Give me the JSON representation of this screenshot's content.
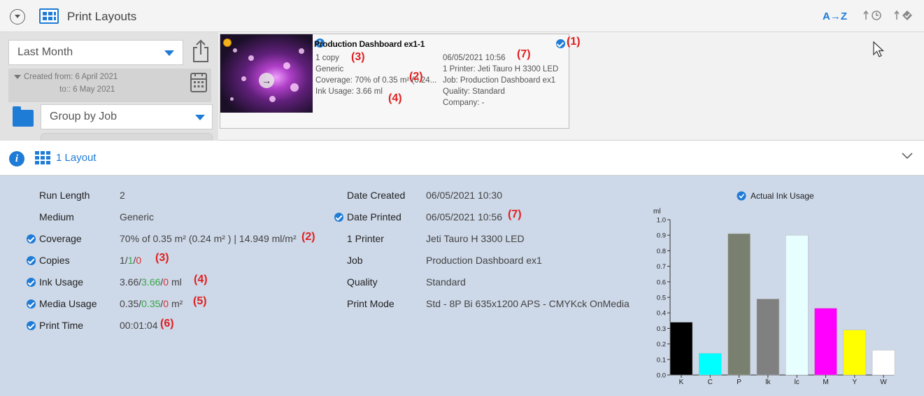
{
  "topbar": {
    "title": "Print Layouts",
    "sort_az": "A→Z",
    "sort_time": "↑🕒",
    "sort_check": "↑◆"
  },
  "filters": {
    "period": "Last Month",
    "created_from": "Created from: 6 April 2021",
    "created_to": "to:: 6 May 2021",
    "group_by": "Group by Job"
  },
  "card": {
    "title": "Production Dashboard ex1-1",
    "info_badge": "1",
    "left": {
      "copies": "1 copy",
      "medium": "Generic",
      "coverage": "Coverage:  70% of 0.35 m² (0.24...",
      "ink_usage": "Ink Usage: 3.66 ml"
    },
    "right": {
      "date": "06/05/2021 10:56",
      "printer": "1 Printer: Jeti Tauro H 3300 LED",
      "job": "Job: Production Dashboard ex1",
      "quality": "Quality: Standard",
      "company": "Company:  -"
    }
  },
  "annotations": {
    "a1": "(1)",
    "a2": "(2)",
    "a3": "(3)",
    "a4": "(4)",
    "a5": "(5)",
    "a6": "(6)",
    "a7": "(7)"
  },
  "details_header": {
    "layout_count": "1 Layout"
  },
  "details": {
    "run_length_label": "Run Length",
    "run_length_value": "2",
    "medium_label": "Medium",
    "medium_value": "Generic",
    "coverage_label": "Coverage",
    "coverage_value": "70% of 0.35 m² (0.24 m² )  |  14.949 ml/m²",
    "copies_label": "Copies",
    "copies": {
      "a": "1",
      "b": "1",
      "c": "0",
      "sep": "/"
    },
    "ink_label": "Ink Usage",
    "ink": {
      "a": "3.66",
      "b": "3.66",
      "c": "0",
      "unit": " ml"
    },
    "media_label": "Media Usage",
    "media": {
      "a": "0.35",
      "b": "0.35",
      "c": "0",
      "unit": " m²"
    },
    "print_time_label": "Print Time",
    "print_time_value": "00:01:04",
    "date_created_label": "Date Created",
    "date_created_value": "06/05/2021 10:30",
    "date_printed_label": "Date Printed",
    "date_printed_value": "06/05/2021 10:56",
    "printer_label": "1 Printer",
    "printer_value": "Jeti Tauro H 3300 LED",
    "job_label": "Job",
    "job_value": "Production Dashboard ex1",
    "quality_label": "Quality",
    "quality_value": "Standard",
    "print_mode_label": "Print Mode",
    "print_mode_value": "Std - 8P Bi 635x1200 APS - CMYKck OnMedia"
  },
  "colors": {
    "accent": "#1e7bd6",
    "annotation": "#e02020",
    "panel_bg": "#cdd8e8"
  },
  "chart_data": {
    "type": "bar",
    "title": "Actual Ink Usage",
    "ylabel": "ml",
    "xlabel": "",
    "ylim": [
      0,
      1.0
    ],
    "yticks": [
      "0.0",
      "0.1",
      "0.2",
      "0.3",
      "0.4",
      "0.5",
      "0.6",
      "0.7",
      "0.8",
      "0.9",
      "1.0"
    ],
    "categories": [
      "K",
      "C",
      "P",
      "lk",
      "lc",
      "M",
      "Y",
      "W"
    ],
    "values": [
      0.34,
      0.14,
      0.91,
      0.49,
      0.9,
      0.43,
      0.29,
      0.16
    ],
    "bar_colors": [
      "#000000",
      "#00ffff",
      "#7a8070",
      "#808080",
      "#e8ffff",
      "#ff00ff",
      "#ffff00",
      "#ffffff"
    ],
    "grid": false
  }
}
